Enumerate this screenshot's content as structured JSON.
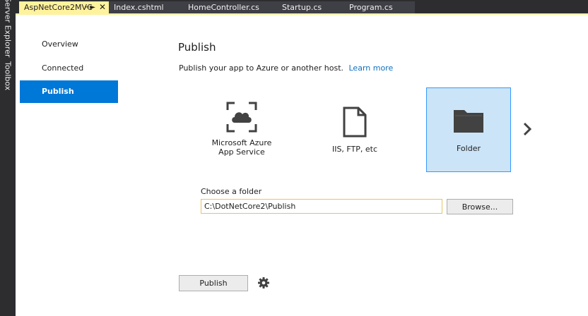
{
  "side_strip": {
    "items": [
      {
        "label": "Server Explorer"
      },
      {
        "label": "Toolbox"
      }
    ]
  },
  "tabs": [
    {
      "label": "AspNetCore2MVC",
      "active": true,
      "pin_icon": "pin-icon",
      "close_icon": "close-icon"
    },
    {
      "label": "Index.cshtml"
    },
    {
      "label": "HomeController.cs"
    },
    {
      "label": "Startup.cs"
    },
    {
      "label": "Program.cs"
    }
  ],
  "nav": {
    "items": [
      {
        "label": "Overview"
      },
      {
        "label": "Connected Services"
      },
      {
        "label": "Publish",
        "selected": true
      }
    ]
  },
  "main": {
    "title": "Publish",
    "subtitle": "Publish your app to Azure or another host.",
    "learn_more": "Learn more",
    "targets": [
      {
        "label": "Microsoft Azure App Service",
        "icon": "azure-cloud-icon"
      },
      {
        "label": "IIS, FTP, etc",
        "icon": "file-icon"
      },
      {
        "label": "Folder",
        "icon": "folder-icon",
        "selected": true
      }
    ],
    "next_icon": "chevron-right-icon",
    "folder": {
      "label": "Choose a folder",
      "value": "C:\\DotNetCore2\\Publish",
      "browse_label": "Browse..."
    },
    "publish_label": "Publish",
    "settings_icon": "gear-icon"
  },
  "colors": {
    "accent": "#0078d7",
    "active_tab": "#fff29d",
    "selected_target_bg": "#cce4f7",
    "link": "#0e70c0",
    "chrome": "#2d2d30"
  }
}
